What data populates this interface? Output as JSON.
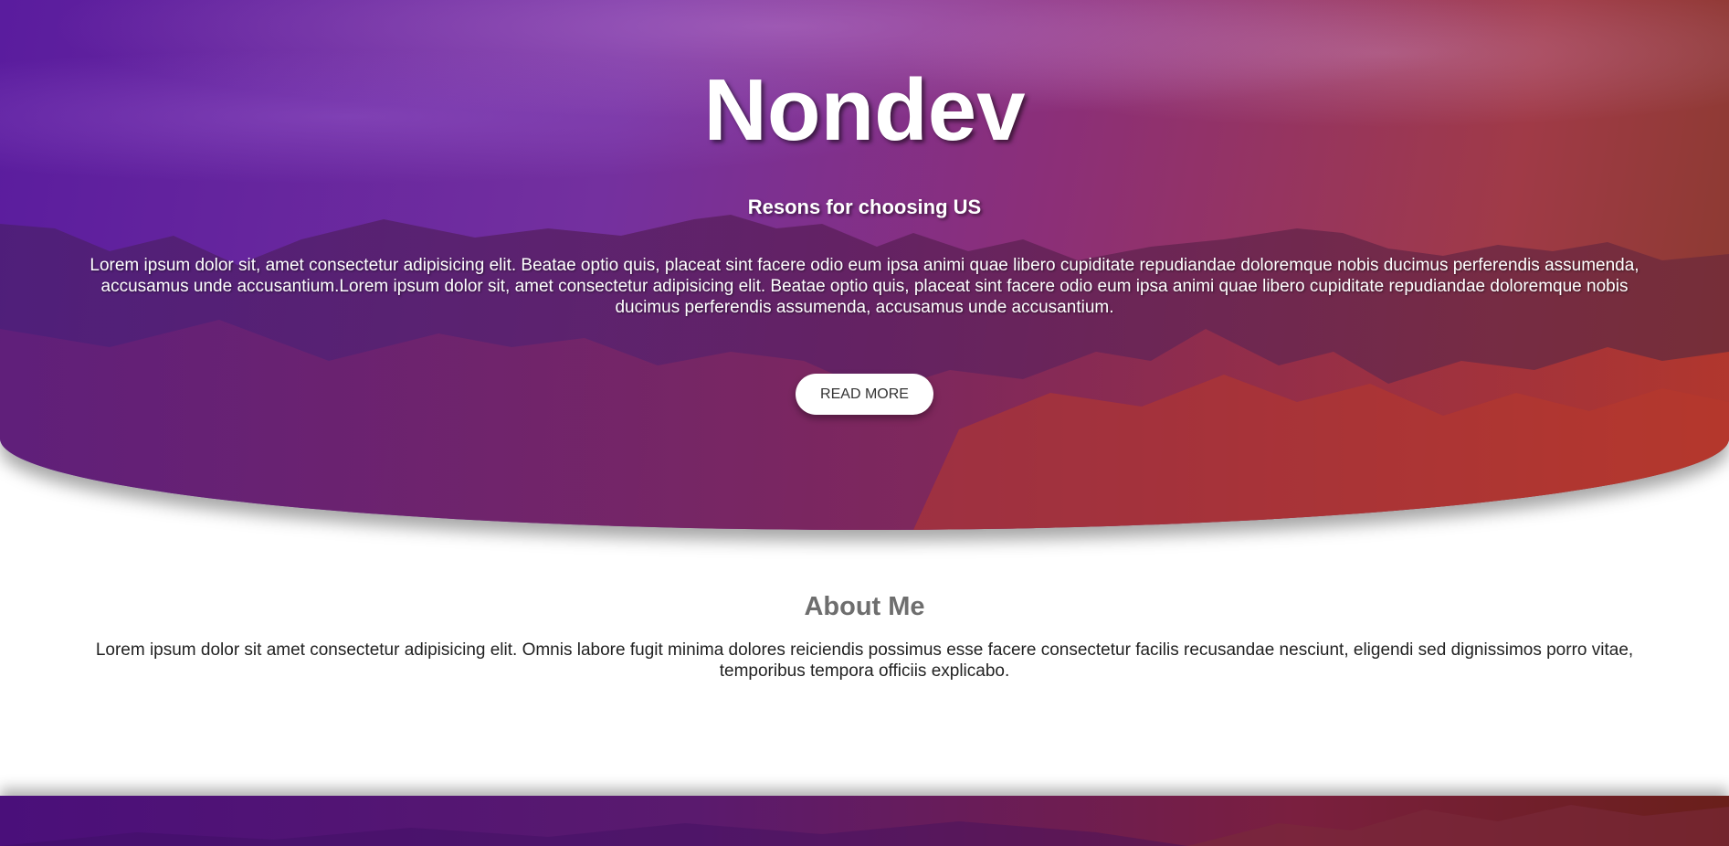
{
  "hero": {
    "title": "Nondev",
    "subtitle": "Resons for choosing US",
    "text": "Lorem ipsum dolor sit, amet consectetur adipisicing elit. Beatae optio quis, placeat sint facere odio eum ipsa animi quae libero cupiditate repudiandae doloremque nobis ducimus perferendis assumenda, accusamus unde accusantium.Lorem ipsum dolor sit, amet consectetur adipisicing elit. Beatae optio quis, placeat sint facere odio eum ipsa animi quae libero cupiditate repudiandae doloremque nobis ducimus perferendis assumenda, accusamus unde accusantium.",
    "button_label": "READ MORE"
  },
  "about": {
    "title": "About Me",
    "text": "Lorem ipsum dolor sit amet consectetur adipisicing elit. Omnis labore fugit minima dolores reiciendis possimus esse facere consectetur facilis recusandae nesciunt, eligendi sed dignissimos porro vitae, temporibus tempora officiis explicabo."
  },
  "colors": {
    "hero_gradient_start": "#5a1c9e",
    "hero_gradient_end": "#a03a47",
    "button_bg": "#ffffff",
    "about_title": "#6e6e6e"
  }
}
